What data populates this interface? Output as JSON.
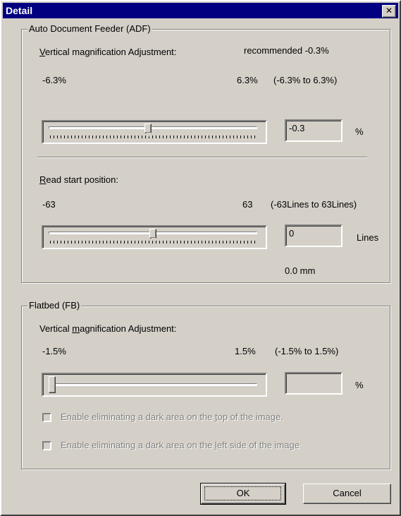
{
  "window": {
    "title": "Detail",
    "close_glyph": "✕"
  },
  "adf": {
    "group_title": "Auto Document Feeder (ADF)",
    "vertical": {
      "label_hotkey": "V",
      "label_rest": "ertical magnification Adjustment:",
      "recommended": "recommended  -0.3%",
      "min": "-6.3%",
      "max": "6.3%",
      "range": "(-6.3% to 6.3%)",
      "value": "-0.3",
      "unit": "%",
      "slider_fraction": 0.476
    },
    "read_start": {
      "label_hotkey": "R",
      "label_rest": "ead start position:",
      "min": "-63",
      "max": "63",
      "range": "(-63Lines to 63Lines)",
      "value": "0",
      "unit": "Lines",
      "mm": "0.0 mm",
      "slider_fraction": 0.5
    }
  },
  "fb": {
    "group_title": "Flatbed (FB)",
    "vertical": {
      "label_pre": "Vertical ",
      "label_hotkey": "m",
      "label_post": "agnification Adjustment:",
      "min": "-1.5%",
      "max": "1.5%",
      "range": "(-1.5% to 1.5%)",
      "value": "",
      "unit": "%",
      "slider_fraction": 0.0
    },
    "check_top": {
      "pre": "Enable eliminating a dark area on the ",
      "hotkey": "t",
      "post": "op of the image.",
      "checked": false
    },
    "check_left": {
      "pre": "Enable eliminating a dark area on the ",
      "hotkey": "l",
      "post": "eft side of the image",
      "checked": false
    }
  },
  "buttons": {
    "ok": "OK",
    "cancel": "Cancel"
  }
}
